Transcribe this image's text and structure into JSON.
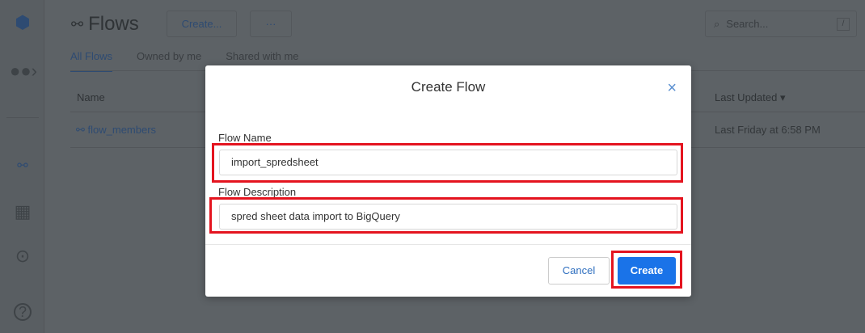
{
  "header": {
    "title": "Flows",
    "create_label": "Create...",
    "more_label": "···",
    "search_placeholder": "Search...",
    "search_shortcut": "/"
  },
  "tabs": [
    "All Flows",
    "Owned by me",
    "Shared with me"
  ],
  "table": {
    "columns": {
      "name": "Name",
      "last_updated": "Last Updated ▾"
    },
    "rows": [
      {
        "name": "flow_members",
        "last_updated": "Last Friday at 6:58 PM"
      }
    ]
  },
  "dialog": {
    "title": "Create Flow",
    "close": "×",
    "flow_name_label": "Flow Name",
    "flow_name_value": "import_spredsheet",
    "flow_desc_label": "Flow Description",
    "flow_desc_value": "spred sheet data import to BigQuery",
    "cancel_label": "Cancel",
    "create_label": "Create"
  },
  "sidebar": {
    "help": "?"
  }
}
